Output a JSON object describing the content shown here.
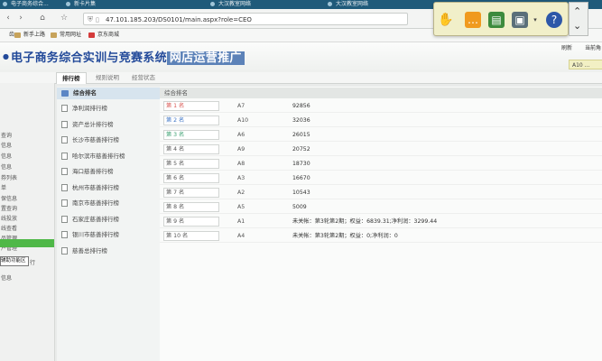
{
  "browser": {
    "tabs": [
      "电子商务综合...",
      "新卡片集",
      "大汉教室网络",
      "大汉教室网络"
    ],
    "url": "47.101.185.203/DS0101/main.aspx?role=CEO",
    "bookmarks": [
      "新手上路",
      "常用网址",
      "京东商城"
    ]
  },
  "app": {
    "title_main": "电子商务综合实训与竞赛系统",
    "title_highlight": "网店运营推广",
    "header_links": [
      "刷新",
      "当前角"
    ],
    "role_text": "A10 ..."
  },
  "tabs": [
    "排行榜",
    "规则说明",
    "经营状态"
  ],
  "sidebar": {
    "items": [
      "",
      "",
      "查询",
      "信息",
      "信息",
      "信息",
      "券列表",
      "单",
      "保信息",
      "置查询",
      "线投放",
      "线查看",
      "品管理",
      "户管理"
    ],
    "lower_items": [
      "行",
      "信息"
    ],
    "tooltip": "辅助功能区"
  },
  "ranking": {
    "header": "综合排名",
    "items": [
      "净利润排行榜",
      "资产总计排行榜",
      "长沙市慈善排行榜",
      "哈尔滨市慈善排行榜",
      "海口慈善排行榜",
      "杭州市慈善排行榜",
      "南京市慈善排行榜",
      "石家庄慈善排行榜",
      "银川市慈善排行榜",
      "慈善总排行榜"
    ]
  },
  "table": {
    "header": "综合排名",
    "rows": [
      {
        "rank": "第 1 名",
        "name": "A7",
        "value": "92856"
      },
      {
        "rank": "第 2 名",
        "name": "A10",
        "value": "32036"
      },
      {
        "rank": "第 3 名",
        "name": "A6",
        "value": "26015"
      },
      {
        "rank": "第 4 名",
        "name": "A9",
        "value": "20752"
      },
      {
        "rank": "第 5 名",
        "name": "A8",
        "value": "18730"
      },
      {
        "rank": "第 6 名",
        "name": "A3",
        "value": "16670"
      },
      {
        "rank": "第 7 名",
        "name": "A2",
        "value": "10543"
      },
      {
        "rank": "第 8 名",
        "name": "A5",
        "value": "5009"
      },
      {
        "rank": "第 9 名",
        "name": "A1",
        "value": "未关帐：第3轮第2期；权益：6839.31;净利润：3299.44"
      },
      {
        "rank": "第 10 名",
        "name": "A4",
        "value": "未关帐：第3轮第2期；权益：0;净利润：0"
      }
    ]
  },
  "colors": {
    "rank_1": "#d9534f",
    "rank_2": "#3a72c4",
    "rank_3": "#3aa070",
    "title": "#234a9a",
    "highlight_bg": "#5c82b8",
    "sidebar_active": "#4fb848"
  }
}
